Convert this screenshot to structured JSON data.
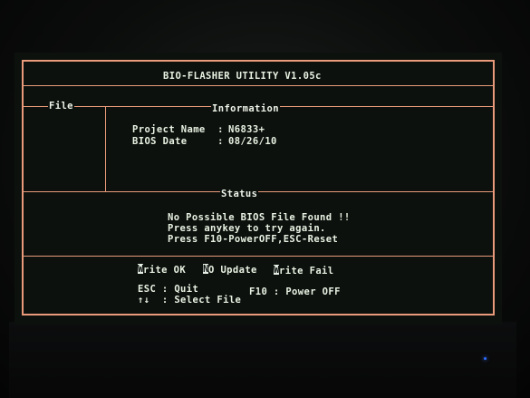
{
  "window": {
    "title": "BIO-FLASHER UTILITY V1.05c"
  },
  "sections": {
    "file": "File",
    "information": "Information",
    "status": "Status"
  },
  "information": {
    "project_label": "Project Name  :",
    "project_value": "N6833+",
    "bios_date_label": "BIOS Date     :",
    "bios_date_value": "08/26/10"
  },
  "status": {
    "line1": "No Possible BIOS File Found !!",
    "line2": "Press anykey to try again.",
    "line3": "Press F10-PowerOFF,ESC-Reset"
  },
  "legend": {
    "write_ok_letter": "W",
    "write_ok_rest": "rite OK",
    "no_update_letter": "N",
    "no_update_rest": "O Update",
    "write_fail_letter": "W",
    "write_fail_rest": "rite Fail"
  },
  "keys": {
    "esc": "ESC : Quit",
    "f10": "F10 : Power OFF",
    "arrows": "↑↓  : Select File"
  },
  "colors": {
    "frame": "#e89a7a",
    "text": "#e8f2e2",
    "background": "#0d110e",
    "led": "#2f6cff"
  }
}
